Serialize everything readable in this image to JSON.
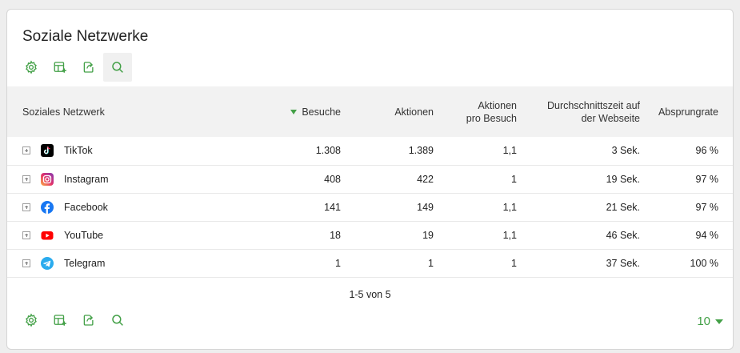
{
  "widget": {
    "title": "Soziale Netzwerke",
    "accent_color": "#43a047"
  },
  "toolbar_icons": [
    "gear-icon",
    "table-add-icon",
    "export-icon",
    "search-icon"
  ],
  "table": {
    "columns": {
      "network": "Soziales Netzwerk",
      "visits": "Besuche",
      "actions": "Aktionen",
      "actions_per_visit_1": "Aktionen",
      "actions_per_visit_2": "pro Besuch",
      "avg_time_1": "Durchschnittszeit auf",
      "avg_time_2": "der Webseite",
      "bounce": "Absprungrate"
    },
    "sorted_by": "Besuche",
    "rows": [
      {
        "name": "TikTok",
        "icon": "tiktok-icon",
        "visits": "1.308",
        "actions": "1.389",
        "apv": "1,1",
        "time": "3 Sek.",
        "bounce": "96 %"
      },
      {
        "name": "Instagram",
        "icon": "instagram-icon",
        "visits": "408",
        "actions": "422",
        "apv": "1",
        "time": "19 Sek.",
        "bounce": "97 %"
      },
      {
        "name": "Facebook",
        "icon": "facebook-icon",
        "visits": "141",
        "actions": "149",
        "apv": "1,1",
        "time": "21 Sek.",
        "bounce": "97 %"
      },
      {
        "name": "YouTube",
        "icon": "youtube-icon",
        "visits": "18",
        "actions": "19",
        "apv": "1,1",
        "time": "46 Sek.",
        "bounce": "94 %"
      },
      {
        "name": "Telegram",
        "icon": "telegram-icon",
        "visits": "1",
        "actions": "1",
        "apv": "1",
        "time": "37 Sek.",
        "bounce": "100 %"
      }
    ]
  },
  "pagination": "1-5 von 5",
  "limit": "10"
}
